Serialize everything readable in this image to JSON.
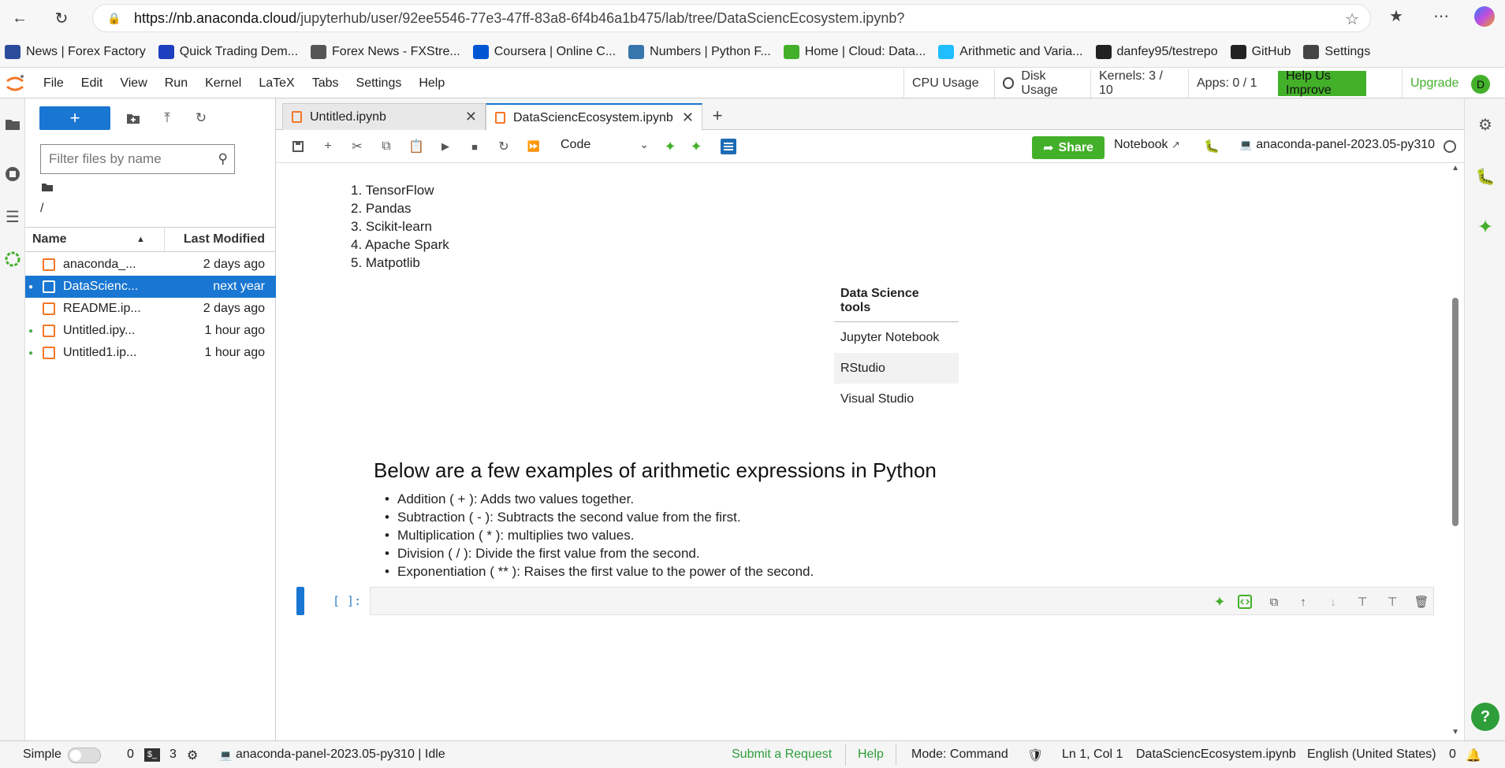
{
  "browser": {
    "url_host": "https://nb.anaconda.cloud",
    "url_path": "/jupyterhub/user/92ee5546-77e3-47ff-83a8-6f4b46a1b475/lab/tree/DataSciencEcosystem.ipynb?",
    "bookmarks": [
      {
        "label": "News | Forex Factory",
        "icon": "forex-factory-icon",
        "color": "#2b4c9b"
      },
      {
        "label": "Quick Trading Dem...",
        "icon": "trading-icon",
        "color": "#1d3fbf"
      },
      {
        "label": "Forex News - FXStre...",
        "icon": "fxstreet-icon",
        "color": "#555555"
      },
      {
        "label": "Coursera | Online C...",
        "icon": "coursera-icon",
        "color": "#0056d2"
      },
      {
        "label": "Numbers | Python F...",
        "icon": "python-icon",
        "color": "#3776ab"
      },
      {
        "label": "Home | Cloud: Data...",
        "icon": "anaconda-icon",
        "color": "#43b02a"
      },
      {
        "label": "Arithmetic and Varia...",
        "icon": "kaggle-icon",
        "color": "#20beff"
      },
      {
        "label": "danfey95/testrepo",
        "icon": "github-icon",
        "color": "#222222"
      },
      {
        "label": "GitHub",
        "icon": "github-icon",
        "color": "#222222"
      },
      {
        "label": "Settings",
        "icon": "gear-icon",
        "color": "#444444"
      }
    ]
  },
  "menubar": {
    "items": [
      "File",
      "Edit",
      "View",
      "Run",
      "Kernel",
      "LaTeX",
      "Tabs",
      "Settings",
      "Help"
    ],
    "cpu": "CPU Usage",
    "disk": "Disk Usage",
    "kernels": "Kernels: 3 / 10",
    "apps": "Apps: 0 / 1",
    "help_improve": "Help Us Improve",
    "upgrade": "Upgrade",
    "avatar": "D"
  },
  "filebrowser": {
    "new_label": "+",
    "filter_placeholder": "Filter files by name",
    "crumb": "/",
    "col_name": "Name",
    "col_modified": "Last Modified",
    "files": [
      {
        "name": "anaconda_...",
        "modified": "2 days ago",
        "running": false,
        "selected": false
      },
      {
        "name": "DataScienc...",
        "modified": "next year",
        "running": true,
        "selected": true
      },
      {
        "name": "README.ip...",
        "modified": "2 days ago",
        "running": false,
        "selected": false
      },
      {
        "name": "Untitled.ipy...",
        "modified": "1 hour ago",
        "running": true,
        "selected": false
      },
      {
        "name": "Untitled1.ip...",
        "modified": "1 hour ago",
        "running": true,
        "selected": false
      }
    ]
  },
  "tabs": [
    {
      "label": "Untitled.ipynb",
      "active": false
    },
    {
      "label": "DataSciencEcosystem.ipynb",
      "active": true
    }
  ],
  "toolbar": {
    "cell_type": "Code",
    "share": "Share",
    "notebook": "Notebook",
    "kernel": "anaconda-panel-2023.05-py310"
  },
  "notebook": {
    "libraries": [
      "1. TensorFlow",
      "2. Pandas",
      "3. Scikit-learn",
      "4. Apache Spark",
      "5. Matpotlib"
    ],
    "table_header": "Data Science tools",
    "table_rows": [
      "Jupyter Notebook",
      "RStudio",
      "Visual Studio"
    ],
    "heading": "Below are a few examples of arithmetic expressions in Python",
    "bullets": [
      "Addition ( + ): Adds two values together.",
      "Subtraction ( - ): Subtracts the second value from the first.",
      "Multiplication ( * ): multiplies two values.",
      "Division ( / ): Divide the first value from the second.",
      "Exponentiation ( ** ): Raises the first value to the power of the second."
    ],
    "cell_prompt": "[ ]:"
  },
  "statusbar": {
    "simple": "Simple",
    "terminals": "0",
    "kernels": "3",
    "kernel_status": "anaconda-panel-2023.05-py310 | Idle",
    "submit": "Submit a Request",
    "help": "Help",
    "mode": "Mode: Command",
    "position": "Ln 1, Col 1",
    "filename": "DataSciencEcosystem.ipynb",
    "language": "English (United States)",
    "notifications": "0"
  }
}
